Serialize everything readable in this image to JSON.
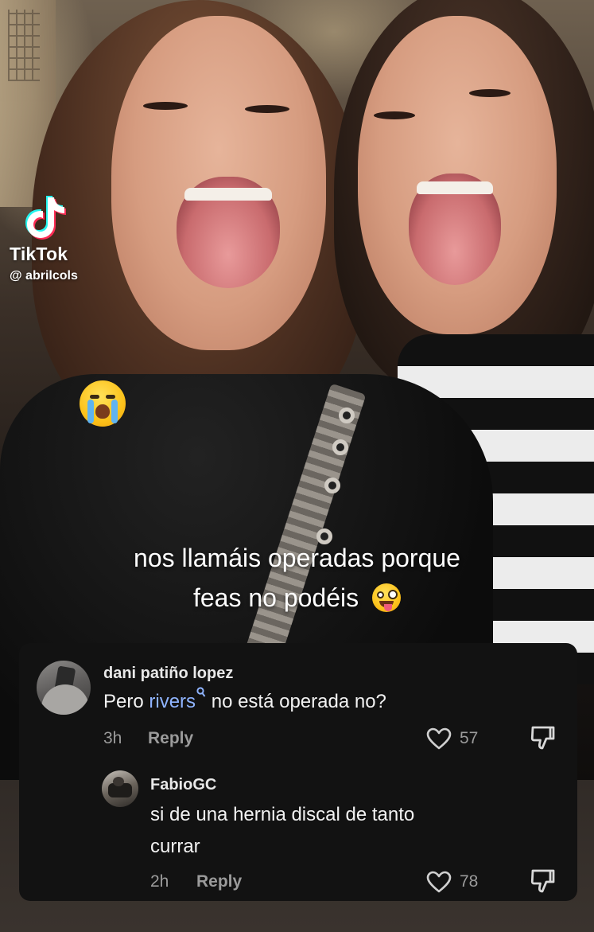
{
  "video": {
    "watermark_brand": "TikTok",
    "watermark_handle": "@ abrilcols",
    "caption_line1": "nos llamáis operadas porque",
    "caption_line2": "feas no podéis",
    "emoji_top": "loudly-crying-face",
    "emoji_caption": "zany-face"
  },
  "comments": [
    {
      "username": "dani patiño lopez",
      "text_before": "Pero ",
      "mention": "rivers",
      "text_after": " no está operada no?",
      "time": "3h",
      "reply_label": "Reply",
      "likes": "57"
    },
    {
      "username": "FabioGC",
      "text_line1": "si de una hernia discal de tanto",
      "text_line2": "currar",
      "time": "2h",
      "reply_label": "Reply",
      "likes": "78"
    }
  ],
  "colors": {
    "card_bg": "#121212",
    "mention": "#8fb4ff",
    "meta": "#9b9b9b"
  }
}
